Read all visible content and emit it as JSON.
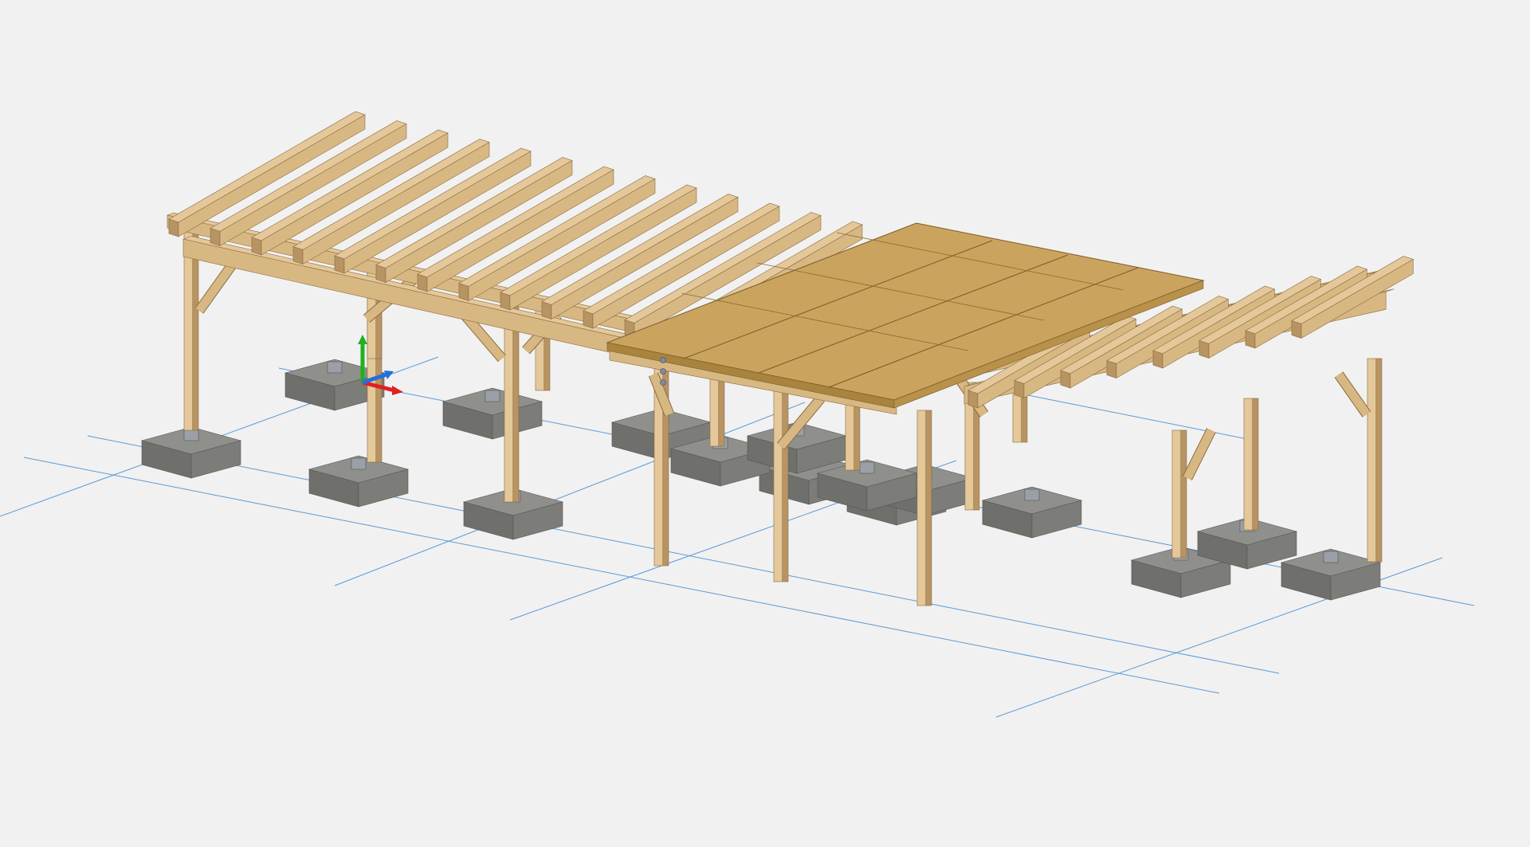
{
  "viewport": {
    "background": "#f1f1f1"
  },
  "model": {
    "structures": [
      "left-carport",
      "middle-carport",
      "right-carport"
    ],
    "colors": {
      "wood_light": "#e4c89a",
      "wood_mid": "#d8b882",
      "wood_dark": "#b89462",
      "panel_top": "#caa45e",
      "panel_dark": "#a8843e",
      "concrete_top": "#8f8f8b",
      "concrete_side": "#6f6f6b",
      "steel": "#9aa0a6",
      "grid_line": "#5b9bd5"
    }
  },
  "axis_gizmo": {
    "x_color": "#e02020",
    "y_color": "#20b020",
    "z_color": "#2070e0"
  }
}
